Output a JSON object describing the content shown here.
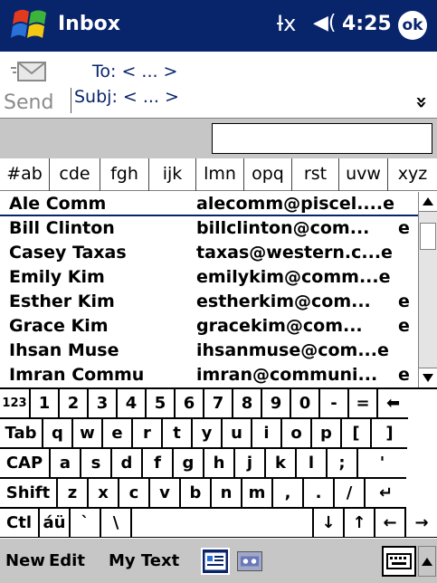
{
  "title_bar": {
    "app_title": "Inbox",
    "signal": "Ɨx",
    "volume": "◀(",
    "time": "4:25",
    "ok_label": "ok"
  },
  "header": {
    "send_label": "Send",
    "to_text": "To: < ... >",
    "subj_text": "Subj: < ... >",
    "expand_glyph": "»"
  },
  "find_bar": {
    "value": ""
  },
  "letter_tabs": [
    "#ab",
    "cde",
    "fgh",
    "ijk",
    "lmn",
    "opq",
    "rst",
    "uvw",
    "xyz"
  ],
  "contacts": [
    {
      "name": "Ale Comm",
      "email": "alecomm@piscel....e",
      "type": ""
    },
    {
      "name": "Bill Clinton",
      "email": "billclinton@com...",
      "type": "e"
    },
    {
      "name": "Casey Taxas",
      "email": "taxas@western.c...e",
      "type": ""
    },
    {
      "name": "Emily Kim",
      "email": "emilykim@comm...e",
      "type": ""
    },
    {
      "name": "Esther Kim",
      "email": "estherkim@com...",
      "type": "e"
    },
    {
      "name": "Grace Kim",
      "email": "gracekim@com...",
      "type": "e"
    },
    {
      "name": "Ihsan Muse",
      "email": "ihsanmuse@com...e",
      "type": ""
    },
    {
      "name": "Imran Commu",
      "email": "imran@communi...",
      "type": "e"
    }
  ],
  "keyboard": {
    "row1": [
      "123",
      "1",
      "2",
      "3",
      "4",
      "5",
      "6",
      "7",
      "8",
      "9",
      "0",
      "-",
      "=",
      "⬅"
    ],
    "row2": [
      "Tab",
      "q",
      "w",
      "e",
      "r",
      "t",
      "y",
      "u",
      "i",
      "o",
      "p",
      "[",
      "]"
    ],
    "row3": [
      "CAP",
      "a",
      "s",
      "d",
      "f",
      "g",
      "h",
      "j",
      "k",
      "l",
      ";",
      "'"
    ],
    "row4": [
      "Shift",
      "z",
      "x",
      "c",
      "v",
      "b",
      "n",
      "m",
      ",",
      ".",
      "/",
      "↵"
    ],
    "row5": [
      "Ctl",
      "áü",
      "`",
      "\\",
      "",
      "↓",
      "↑",
      "←",
      "→"
    ]
  },
  "bottom_bar": {
    "new_label": "New",
    "edit_label": "Edit",
    "mytext_label": "My Text"
  },
  "colors": {
    "titlebar": "#08246b",
    "toolbar": "#c6c6c6"
  }
}
